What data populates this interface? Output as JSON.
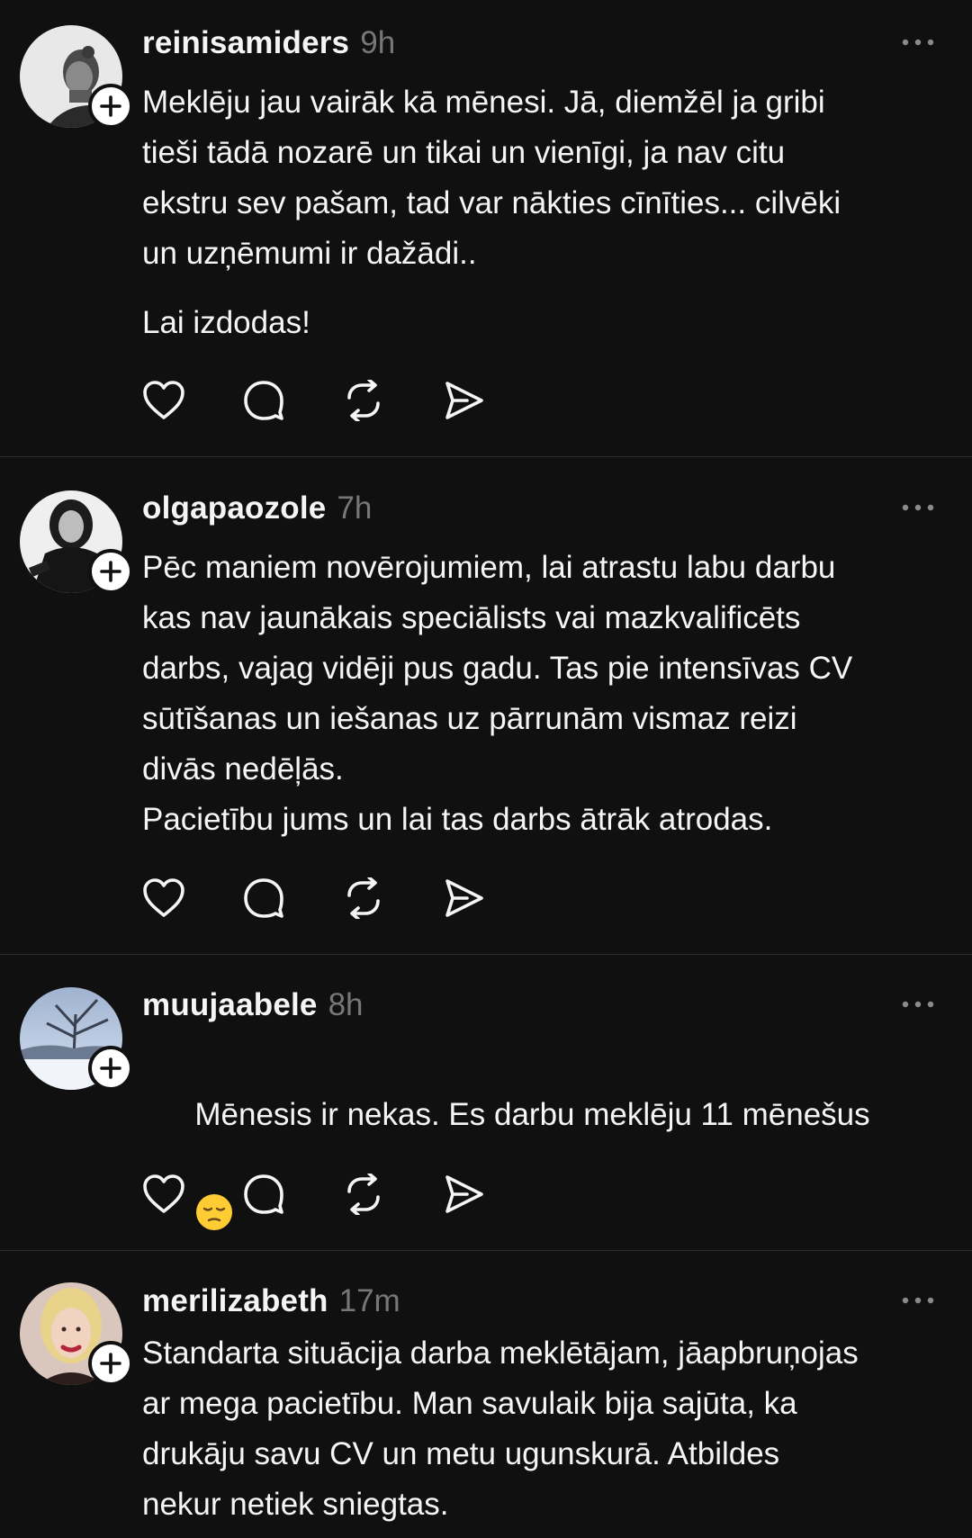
{
  "posts": [
    {
      "username": "reinisamiders",
      "time": "9h",
      "text": "Meklēju jau vairāk kā mēnesi. Jā, diemžēl ja gribi\ntieši tādā nozarē un tikai un vienīgi, ja nav citu\nekstru sev pašam, tad var nākties cīnīties... cilvēki\nun uzņēmumi ir dažādi..",
      "text2": "Lai izdodas!"
    },
    {
      "username": "olgapaozole",
      "time": "7h",
      "text": "Pēc maniem novērojumiem, lai atrastu labu darbu\nkas nav jaunākais speciālists vai mazkvalificēts\ndarbs, vajag vidēji pus gadu. Tas pie intensīvas CV\nsūtīšanas un iešanas uz pārrunām vismaz reizi\ndivās nedēļās.\nPacietību jums un lai tas darbs ātrāk atrodas."
    },
    {
      "username": "muujaabele",
      "time": "8h",
      "text": "Mēnesis ir nekas. Es darbu meklēju 11 mēnešus",
      "emoji": "pensive-face"
    },
    {
      "username": "merilizabeth",
      "time": "17m",
      "text": "Standarta situācija darba meklētājam, jāapbruņojas\nar mega pacietību. Man savulaik bija sajūta, ka\ndrukāju savu CV un metu ugunskurā. Atbildes\nnekur netiek sniegtas."
    }
  ],
  "icons": {
    "like": "heart-icon",
    "reply": "comment-icon",
    "repost": "repost-icon",
    "share": "send-icon",
    "more": "more-options-icon",
    "follow": "plus-icon"
  },
  "colors": {
    "background": "#101010",
    "text": "#f3f5f7",
    "muted": "#777777",
    "divider": "#2d2d2d"
  }
}
